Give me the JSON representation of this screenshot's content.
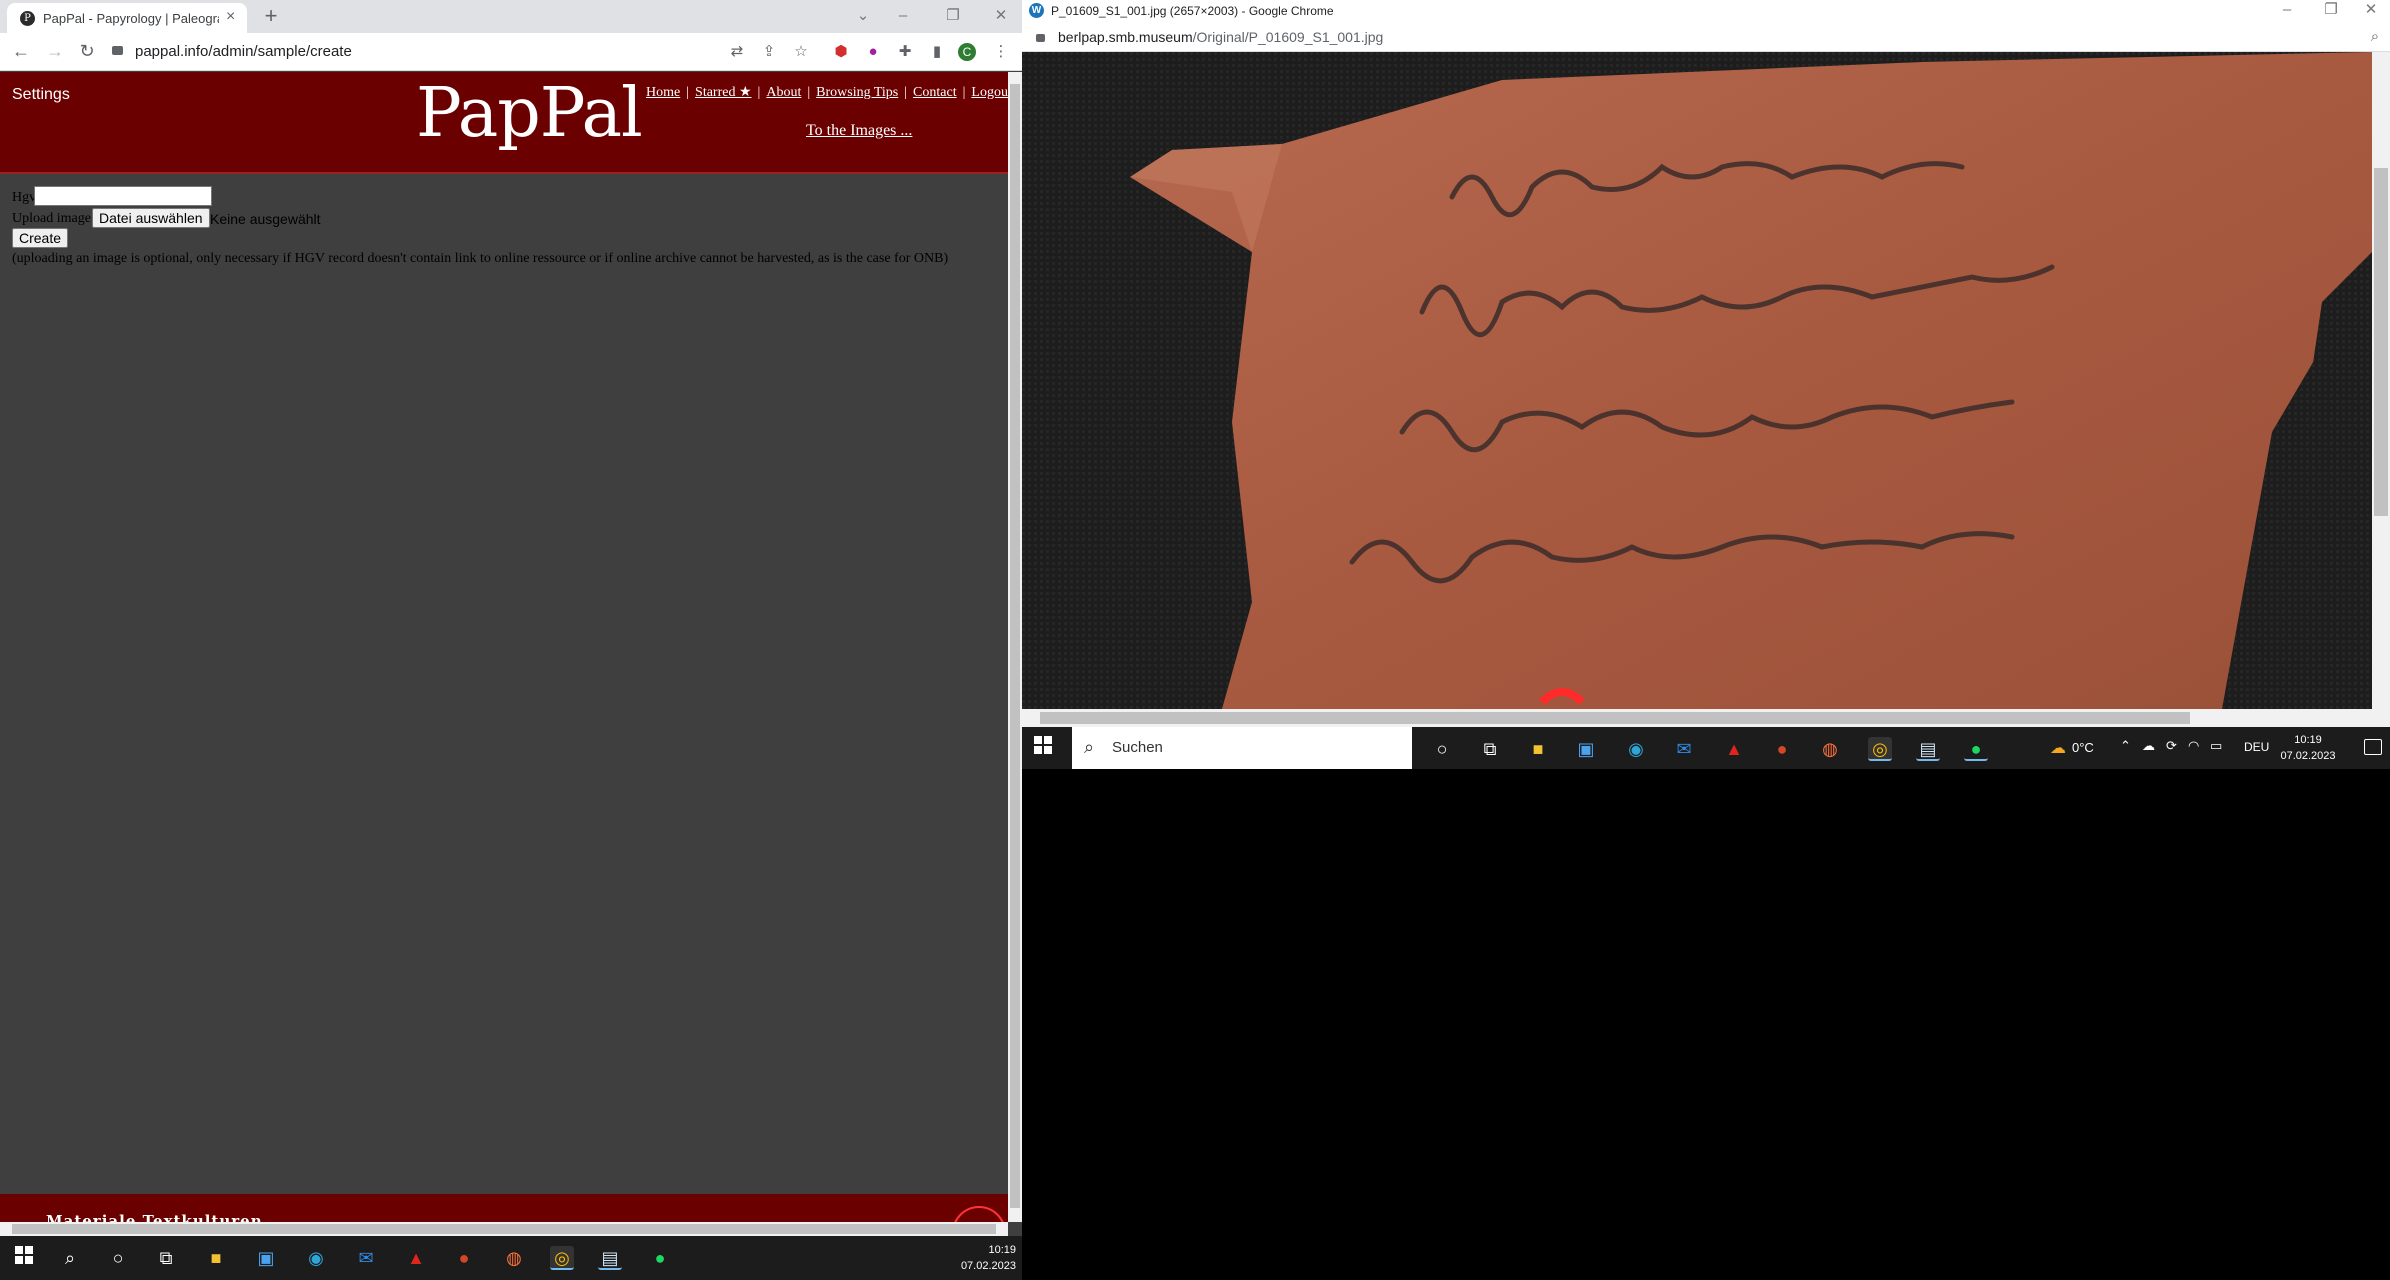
{
  "left_window": {
    "tab": {
      "title": "PapPal - Papyrology | Paleograph",
      "favicon": "P"
    },
    "url": "pappal.info/admin/sample/create",
    "profile_initial": "C",
    "header": {
      "settings": "Settings",
      "logo": "PapPal",
      "nav": [
        "Home",
        "Starred ★",
        "About",
        "Browsing Tips",
        "Contact",
        "Logou"
      ],
      "to_images": "To the Images ..."
    },
    "form": {
      "hgv_label": "Hgv",
      "hgv_value": "",
      "upload_label": "Upload image",
      "file_button": "Datei auswählen",
      "file_none": "Keine ausgewählt",
      "create_button": "Create",
      "note": "(uploading an image is optional, only necessary if HGV record doesn't contain link to online ressource or if online archive cannot be harvested, as is the case for ONB)"
    },
    "footer": {
      "text": "Materiale Textkulturen"
    },
    "colors": {
      "header_bg": "#6b0000",
      "page_bg": "#3f3f3f"
    }
  },
  "left_taskbar": {
    "time": "10:19",
    "date": "07.02.2023",
    "icons": [
      "windows-start",
      "search",
      "cortana",
      "task-view",
      "file-explorer",
      "store",
      "edge",
      "mail",
      "acrobat",
      "powerpoint",
      "firefox",
      "chrome",
      "notepad",
      "spotify"
    ]
  },
  "right_window": {
    "title": "P_01609_S1_001.jpg (2657×2003) - Google Chrome",
    "url_host": "berlpap.smb.museum",
    "url_path": "/Original/P_01609_S1_001.jpg"
  },
  "right_taskbar": {
    "search_placeholder": "Suchen",
    "weather": "0°C",
    "language": "DEU",
    "time": "10:19",
    "date": "07.02.2023"
  }
}
